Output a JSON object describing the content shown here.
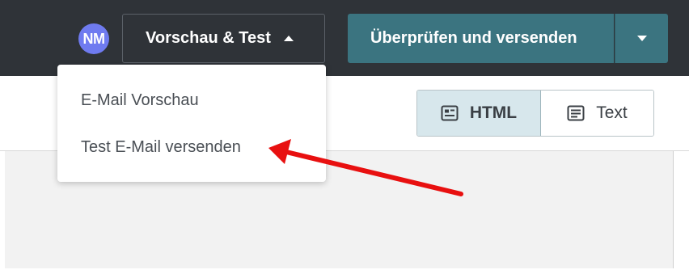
{
  "header": {
    "avatar_initials": "NM",
    "preview_button_label": "Vorschau & Test",
    "send_button_label": "Überprüfen und versenden"
  },
  "preview_menu": {
    "items": [
      {
        "label": "E-Mail Vorschau"
      },
      {
        "label": "Test E-Mail versenden"
      }
    ]
  },
  "format_toggle": {
    "html_label": "HTML",
    "text_label": "Text",
    "selected": "HTML"
  },
  "colors": {
    "header_bg": "#2f3338",
    "accent": "#3b7480",
    "avatar": "#6f7bf0",
    "annotation_arrow": "#e81010"
  },
  "icons": [
    "caret-up-icon",
    "caret-down-icon",
    "html-format-icon",
    "text-format-icon",
    "annotation-arrow"
  ]
}
